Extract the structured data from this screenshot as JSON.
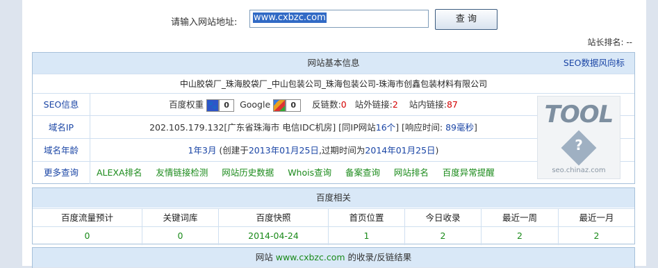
{
  "search": {
    "label": "请输入网站地址:",
    "value": "www.cxbzc.com",
    "button": "查 询"
  },
  "rank_text": "站长排名: --",
  "basic": {
    "title": "网站基本信息",
    "trend_link": "SEO数据风向标",
    "site_title": "中山胶袋厂_珠海胶袋厂_中山包装公司_珠海包装公司-珠海市创鑫包装材料有限公司",
    "seo": {
      "label": "SEO信息",
      "baidu_weight_label": "百度权重",
      "baidu_weight": "0",
      "google_label": "Google",
      "google_pr": "0",
      "backlinks_label": "反链数:",
      "backlinks": "0",
      "external_label": "站外链接:",
      "external": "2",
      "internal_label": "站内链接:",
      "internal": "87"
    },
    "ip": {
      "label": "域名IP",
      "text_a": "202.105.179.132[广东省珠海市 电信IDC机房] [同IP网站",
      "same_ip": "16个",
      "text_b": "] [响应时间: ",
      "response": "89毫秒",
      "text_c": "]"
    },
    "age": {
      "label": "域名年龄",
      "age": "1年3月",
      "text_a": " (创建于",
      "created": "2013年01月25日",
      "text_b": ",过期时间为",
      "expires": "2014年01月25日",
      "text_c": ")"
    },
    "more": {
      "label": "更多查询",
      "links": [
        "ALEXA排名",
        "友情链接检测",
        "网站历史数据",
        "Whois查询",
        "备案查询",
        "网站排名",
        "百度异常提醒"
      ]
    },
    "logo": {
      "word": "TOOL",
      "url": "seo.chinaz.com"
    }
  },
  "baidu": {
    "title": "百度相关",
    "headers": [
      "百度流量预计",
      "关键词库",
      "百度快照",
      "首页位置",
      "今日收录",
      "最近一周",
      "最近一月"
    ],
    "values": [
      "0",
      "0",
      "2014-04-24",
      "1",
      "2",
      "2",
      "2"
    ]
  },
  "result": {
    "prefix": "网站 ",
    "domain": "www.cxbzc.com",
    "suffix": " 的收录/反链结果"
  }
}
